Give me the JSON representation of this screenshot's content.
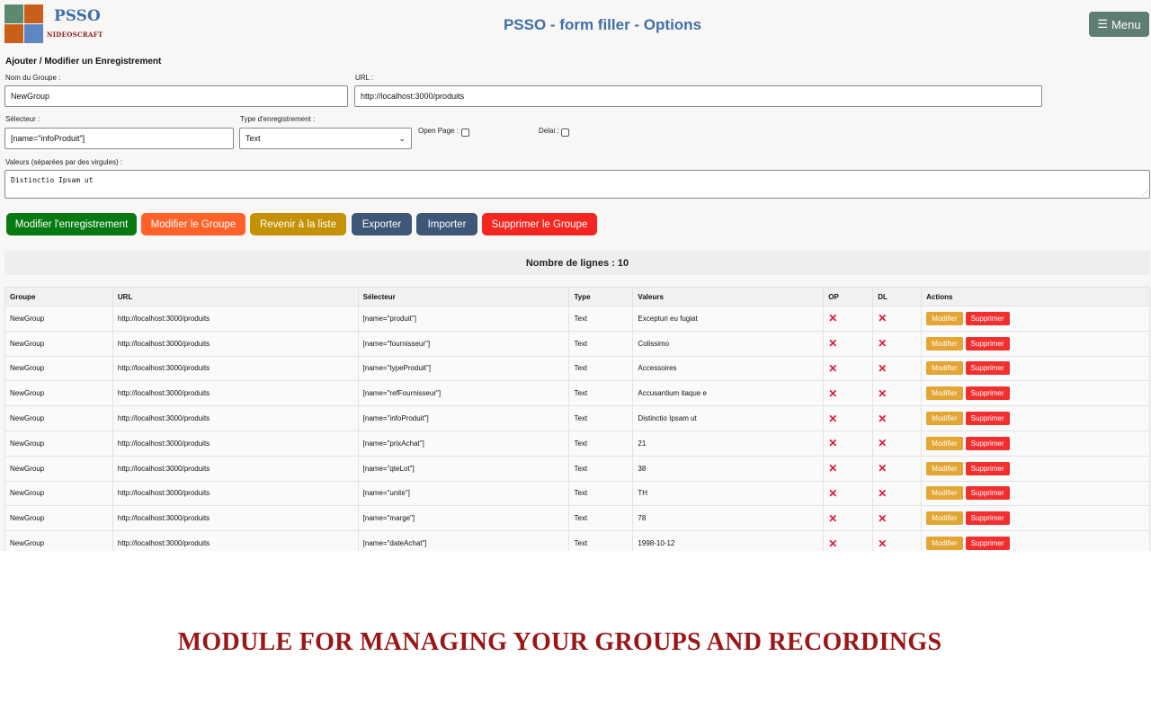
{
  "header": {
    "logo_brand": "PSSO",
    "logo_sub": "NIDEOSCRAFT",
    "title": "PSSO - form filler - Options",
    "menu_icon": "☰",
    "menu_label": "Menu"
  },
  "form": {
    "section_title": "Ajouter / Modifier un Enregistrement",
    "group_label": "Nom du Groupe :",
    "group_value": "NewGroup",
    "url_label": "URL :",
    "url_value": "http://localhost:3000/produits",
    "selector_label": "Sélecteur :",
    "selector_value": "[name=\"infoProduit\"]",
    "type_label": "Type d'enregistrement :",
    "type_value": "Text",
    "open_page_label": "Open Page :",
    "delay_label": "Delai :",
    "values_label": "Valeurs (séparées par des virgules) :",
    "values_value": "Distinctio Ipsam ut"
  },
  "buttons": {
    "edit_record": "Modifier l'enregistrement",
    "edit_group": "Modifier le Groupe",
    "back_to_list": "Revenir à la liste",
    "export": "Exporter",
    "import": "Importer",
    "delete_group": "Supprimer le Groupe"
  },
  "count": {
    "text": "Nombre de lignes : 10"
  },
  "table": {
    "columns": [
      "Groupe",
      "URL",
      "Sélecteur",
      "Type",
      "Valeurs",
      "OP",
      "DL",
      "Actions"
    ],
    "edit_label": "Modifier",
    "delete_label": "Supprimer",
    "x_glyph": "✕",
    "rows": [
      {
        "groupe": "NewGroup",
        "url": "http://localhost:3000/produits",
        "selecteur": "[name=\"produit\"]",
        "type": "Text",
        "valeurs": "Excepturi eu fugiat"
      },
      {
        "groupe": "NewGroup",
        "url": "http://localhost:3000/produits",
        "selecteur": "[name=\"fournisseur\"]",
        "type": "Text",
        "valeurs": "Colissimo"
      },
      {
        "groupe": "NewGroup",
        "url": "http://localhost:3000/produits",
        "selecteur": "[name=\"typeProduit\"]",
        "type": "Text",
        "valeurs": "Accessoires"
      },
      {
        "groupe": "NewGroup",
        "url": "http://localhost:3000/produits",
        "selecteur": "[name=\"refFournisseur\"]",
        "type": "Text",
        "valeurs": "Accusantium itaque e"
      },
      {
        "groupe": "NewGroup",
        "url": "http://localhost:3000/produits",
        "selecteur": "[name=\"infoProduit\"]",
        "type": "Text",
        "valeurs": "Distinctio Ipsam ut"
      },
      {
        "groupe": "NewGroup",
        "url": "http://localhost:3000/produits",
        "selecteur": "[name=\"prixAchat\"]",
        "type": "Text",
        "valeurs": "21"
      },
      {
        "groupe": "NewGroup",
        "url": "http://localhost:3000/produits",
        "selecteur": "[name=\"qteLot\"]",
        "type": "Text",
        "valeurs": "38"
      },
      {
        "groupe": "NewGroup",
        "url": "http://localhost:3000/produits",
        "selecteur": "[name=\"unite\"]",
        "type": "Text",
        "valeurs": "TH"
      },
      {
        "groupe": "NewGroup",
        "url": "http://localhost:3000/produits",
        "selecteur": "[name=\"marge\"]",
        "type": "Text",
        "valeurs": "78"
      },
      {
        "groupe": "NewGroup",
        "url": "http://localhost:3000/produits",
        "selecteur": "[name=\"dateAchat\"]",
        "type": "Text",
        "valeurs": "1998-10-12"
      }
    ]
  },
  "caption": "MODULE FOR MANAGING YOUR GROUPS AND RECORDINGS",
  "colors": {
    "title_blue": "#3d6fa8",
    "menu_button": "#5e7d73",
    "btn_green": "#067a10",
    "btn_orange": "#ff6229",
    "btn_gold": "#c49207",
    "btn_slate": "#3e5677",
    "btn_red": "#f52620",
    "caption_red": "#9b1616",
    "x_red": "#e0143c"
  }
}
